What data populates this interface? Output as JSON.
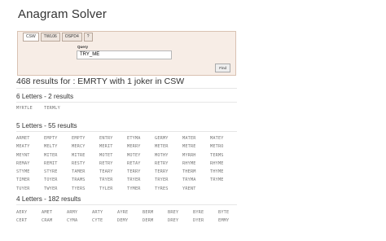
{
  "app": {
    "title": "Anagram Solver"
  },
  "search": {
    "tabs": [
      {
        "label": "CSW",
        "active": true
      },
      {
        "label": "TWL06",
        "active": false
      },
      {
        "label": "OSPD4",
        "active": false
      },
      {
        "label": "?",
        "active": false
      }
    ],
    "query_label": "Query",
    "query_value": "TRY_ME",
    "find_label": "Find"
  },
  "results": {
    "summary": "468 results for : EMRTY with 1 joker in CSW",
    "sections": [
      {
        "heading": "6 Letters - 2 results",
        "words": [
          "MYRTLE",
          "TERMLY"
        ]
      },
      {
        "heading": "5 Letters - 55 results",
        "words": [
          "ARMET",
          "EMPTY",
          "EMPTY",
          "ENTRY",
          "ETYMA",
          "GERMY",
          "MATER",
          "MATEY",
          "MEATY",
          "MELTY",
          "MERCY",
          "MERIT",
          "MERRY",
          "METER",
          "METRE",
          "METRO",
          "MEYNT",
          "MITER",
          "MITRE",
          "MOTET",
          "MOTEY",
          "MOTHY",
          "MYRRH",
          "TERMS",
          "REMAY",
          "REMIT",
          "RESTY",
          "RETRY",
          "RETAY",
          "RETRY",
          "RHYME",
          "RHYME",
          "STYME",
          "STYRE",
          "TAMER",
          "TEARY",
          "TERRY",
          "TERRY",
          "THERM",
          "THYME",
          "TIMER",
          "TOYER",
          "TRAMS",
          "TRYER",
          "TRYER",
          "TRYER",
          "TRYMA",
          "TRYME",
          "TUYER",
          "TWYER",
          "TYERS",
          "TYLER",
          "TYMER",
          "TYRES",
          "YRENT"
        ]
      },
      {
        "heading": "4 Letters - 182 results",
        "words": [
          "AERY",
          "AMET",
          "ARMY",
          "ARTY",
          "AYRE",
          "BERM",
          "BREY",
          "BYRE",
          "BYTE",
          "CERT",
          "CRAM",
          "CYMA",
          "CYTE",
          "DEMY",
          "DERM",
          "DREY",
          "DYER",
          "EMMY"
        ]
      }
    ]
  }
}
